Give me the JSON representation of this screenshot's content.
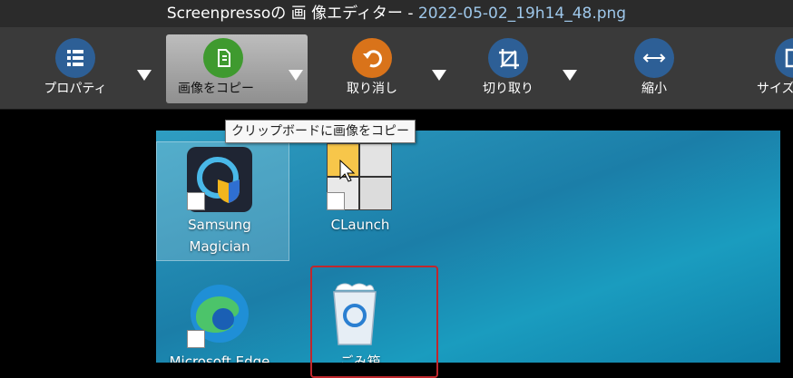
{
  "window": {
    "title_prefix": "Screenpressoの 画 像エディター -",
    "file_name": "2022-05-02_19h14_48.png"
  },
  "toolbar": {
    "items": [
      {
        "label": "プロパティ",
        "icon": "list-icon",
        "color": "#2d5f96"
      },
      {
        "label": "画像をコピー",
        "icon": "copy-icon",
        "color": "#3f9a2f"
      },
      {
        "label": "取り消し",
        "icon": "undo-icon",
        "color": "#d9731a"
      },
      {
        "label": "切り取り",
        "icon": "crop-icon",
        "color": "#2d5f96"
      },
      {
        "label": "縮小",
        "icon": "resize-icon",
        "color": "#2d5f96"
      },
      {
        "label": "サイズ",
        "icon": "size-icon",
        "color": "#2d5f96"
      }
    ]
  },
  "tooltip": {
    "text": "クリップボードに画像をコピー"
  },
  "desktop": {
    "icons": [
      {
        "label_line1": "Samsung",
        "label_line2": "Magician",
        "icon": "samsung-magician-icon"
      },
      {
        "label_line1": "CLaunch",
        "label_line2": "",
        "icon": "claunch-icon"
      },
      {
        "label_line1": "Microsoft Edge",
        "label_line2": "",
        "icon": "edge-icon"
      },
      {
        "label_line1": "ごみ箱",
        "label_line2": "",
        "icon": "recycle-bin-icon"
      }
    ]
  }
}
